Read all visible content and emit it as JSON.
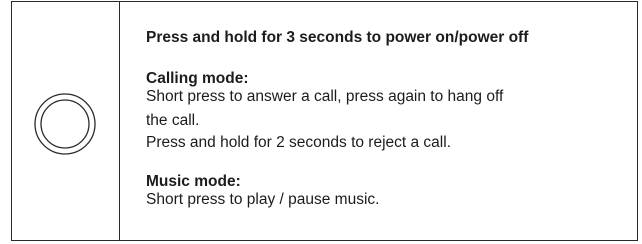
{
  "icon": "round-button-icon",
  "instructions": {
    "power": "Press and hold for 3 seconds to power on/power off",
    "calling": {
      "heading": "Calling mode:",
      "line1": "Short press to answer a call, press again to hang off",
      "line2": "the call.",
      "line3": "Press and hold for 2 seconds to reject a call."
    },
    "music": {
      "heading": "Music mode:",
      "line1": "Short press to play / pause music."
    }
  }
}
